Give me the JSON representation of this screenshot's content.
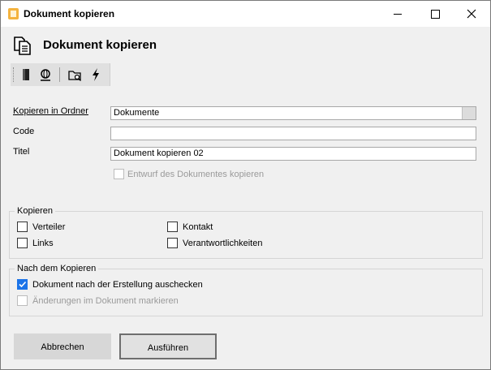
{
  "window": {
    "title": "Dokument kopieren",
    "heading": "Dokument kopieren"
  },
  "icons": {
    "app": "document-copy-icon",
    "heading": "copy-documents-icon",
    "toolbar": [
      "door-exit-icon",
      "globe-icon",
      "folder-search-icon",
      "lightning-icon"
    ]
  },
  "form": {
    "folder_label": "Kopieren in Ordner",
    "folder_value": "Dokumente",
    "code_label": "Code",
    "code_value": "",
    "title_label": "Titel",
    "title_value": "Dokument kopieren 02",
    "draft_label": "Entwurf des Dokumentes kopieren"
  },
  "copy_group": {
    "title": "Kopieren",
    "options": [
      {
        "label": "Verteiler",
        "checked": false
      },
      {
        "label": "Kontakt",
        "checked": false
      },
      {
        "label": "Links",
        "checked": false
      },
      {
        "label": "Verantwortlichkeiten",
        "checked": false
      }
    ]
  },
  "after_group": {
    "title": "Nach dem Kopieren",
    "checkout_label": "Dokument nach der Erstellung auschecken",
    "checkout_checked": true,
    "mark_label": "Änderungen im Dokument markieren",
    "mark_checked": false
  },
  "buttons": {
    "cancel": "Abbrechen",
    "run": "Ausführen"
  },
  "colors": {
    "accent": "#1a73e8",
    "app_icon": "#f4b33e"
  }
}
